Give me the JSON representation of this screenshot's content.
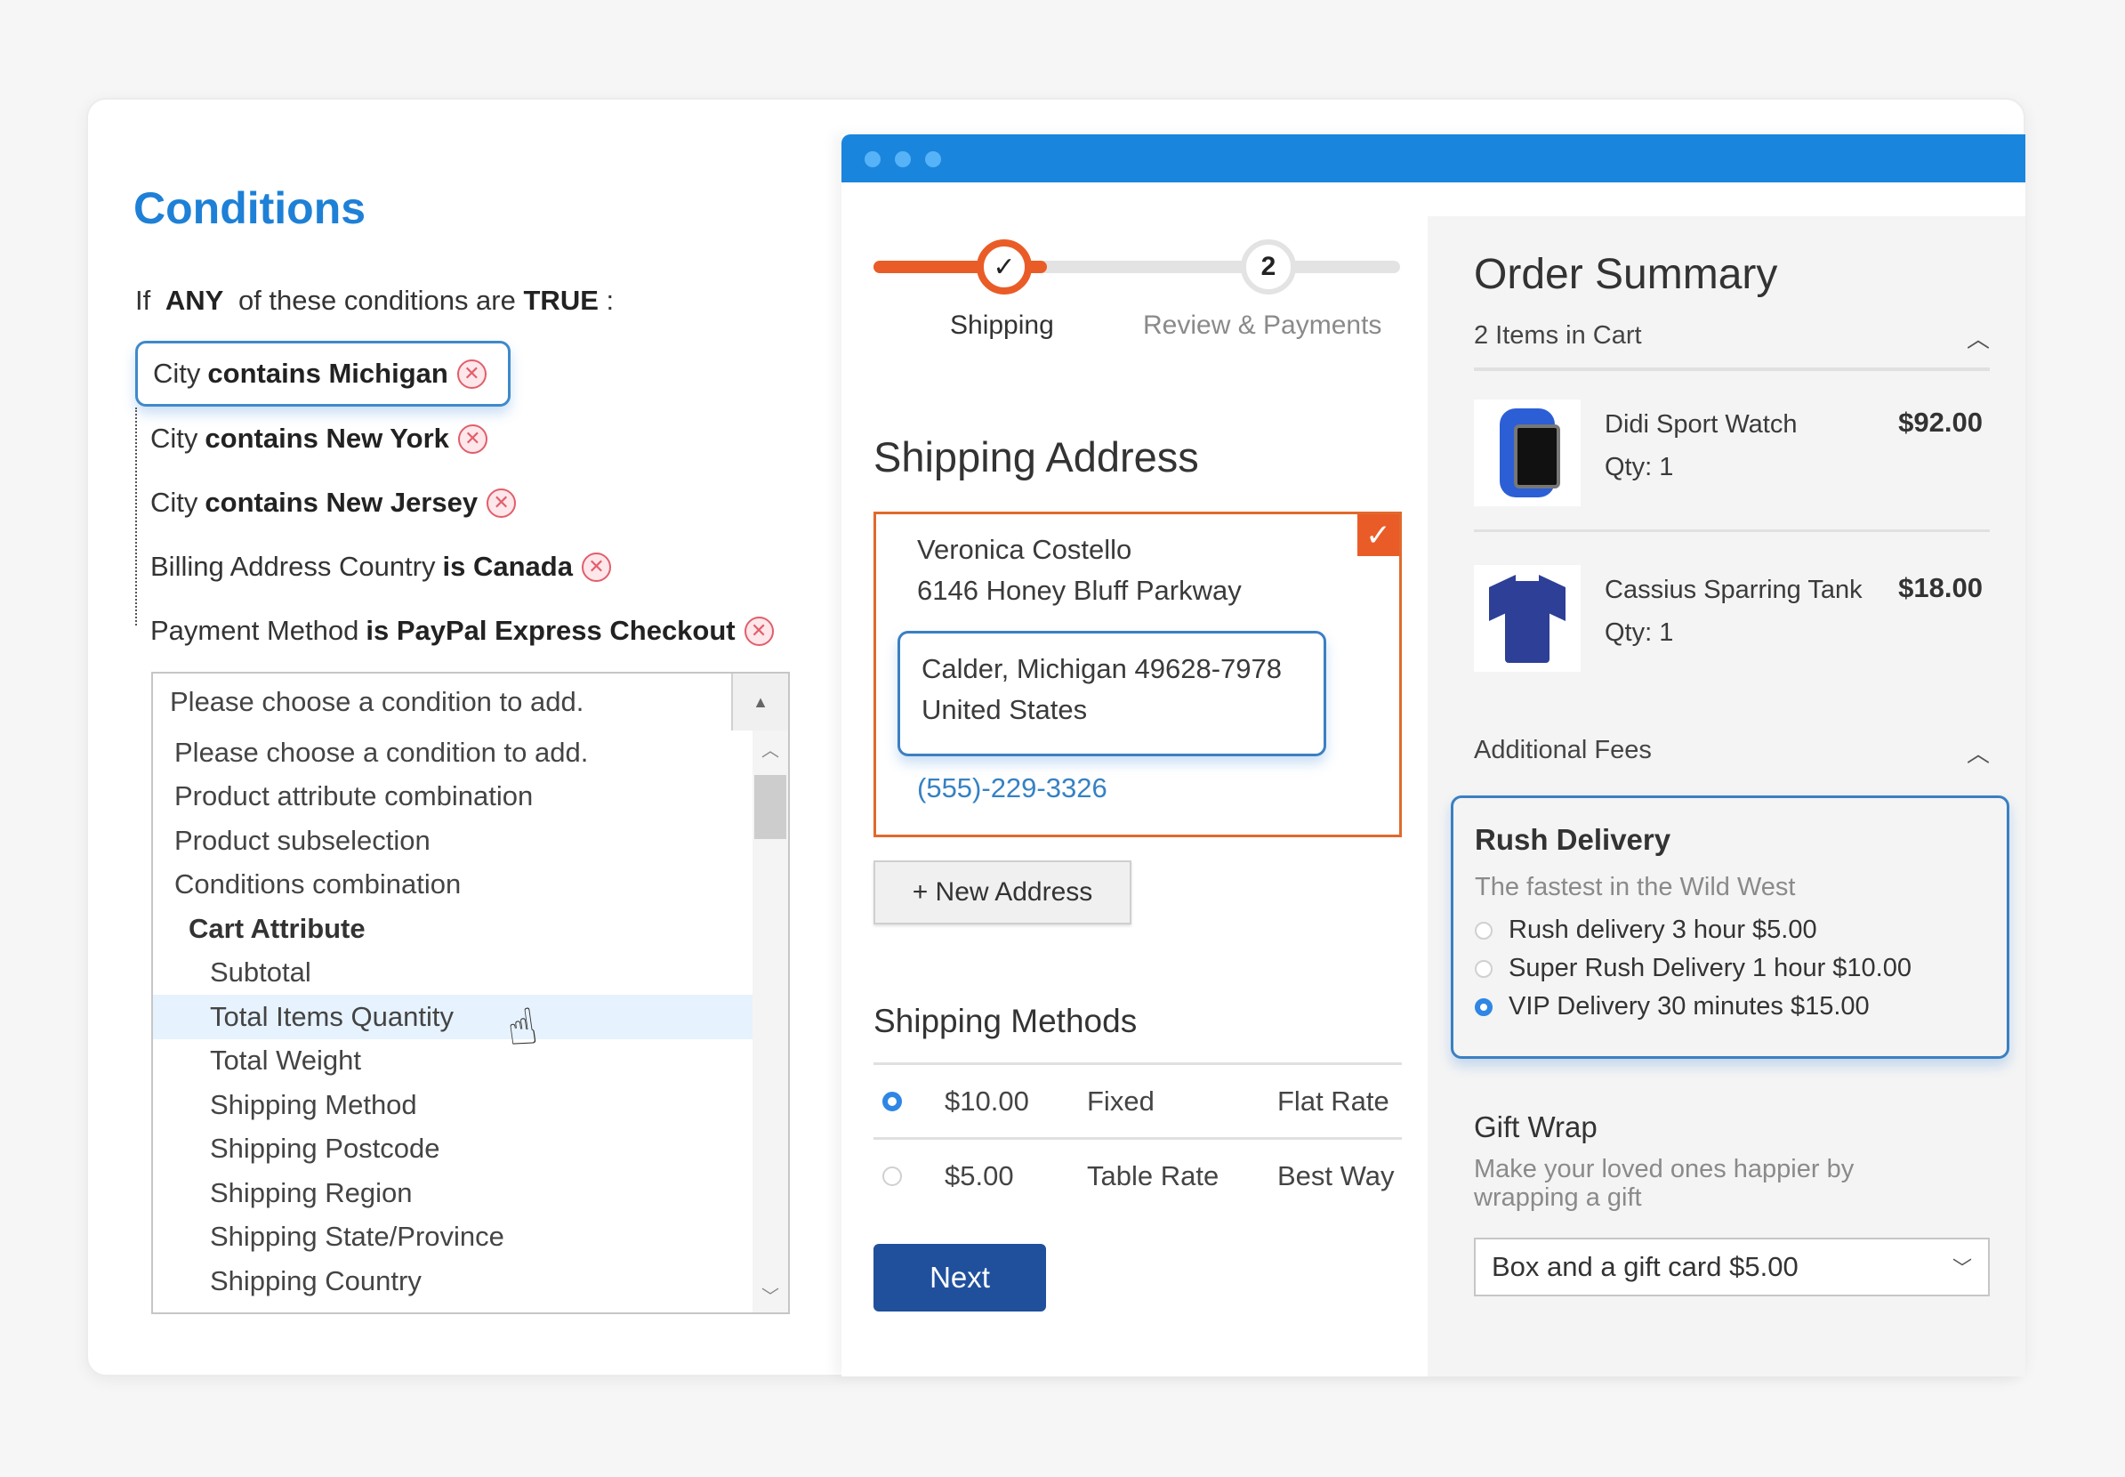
{
  "conditions": {
    "title": "Conditions",
    "intro": {
      "prefix": "If",
      "aggregator": "ANY",
      "middle": "of these conditions are",
      "value": "TRUE",
      "suffix": ":"
    },
    "rules": [
      {
        "attribute": "City",
        "operator_value": "contains Michigan",
        "focused": true
      },
      {
        "attribute": "City",
        "operator_value": "contains New York"
      },
      {
        "attribute": "City",
        "operator_value": "contains New Jersey"
      },
      {
        "attribute": "Billing Address Country",
        "operator_value": "is Canada"
      },
      {
        "attribute": "Payment Method",
        "operator_value": "is PayPal Express Checkout"
      }
    ],
    "remove_icon": "circle-x-icon",
    "select": {
      "value": "Please choose a condition to add.",
      "options": [
        {
          "label": "Please choose a condition to add.",
          "level": 0
        },
        {
          "label": "Product attribute combination",
          "level": 0
        },
        {
          "label": "Product subselection",
          "level": 0
        },
        {
          "label": "Conditions combination",
          "level": 0
        },
        {
          "label": "Cart Attribute",
          "level": 1,
          "group": true
        },
        {
          "label": "Subtotal",
          "level": 2
        },
        {
          "label": "Total Items Quantity",
          "level": 2,
          "hovered": true
        },
        {
          "label": "Total Weight",
          "level": 2
        },
        {
          "label": "Shipping Method",
          "level": 2
        },
        {
          "label": "Shipping Postcode",
          "level": 2
        },
        {
          "label": "Shipping Region",
          "level": 2
        },
        {
          "label": "Shipping State/Province",
          "level": 2
        },
        {
          "label": "Shipping Country",
          "level": 2
        }
      ]
    }
  },
  "checkout": {
    "steps": [
      {
        "label": "Shipping",
        "state": "done",
        "icon": "check-icon"
      },
      {
        "label": "Review & Payments",
        "state": "todo",
        "number": "2"
      }
    ],
    "progress_fraction": 0.33,
    "shipping_address": {
      "title": "Shipping Address",
      "name": "Veronica Costello",
      "street": "6146 Honey Bluff Parkway",
      "city_line": "Calder, Michigan 49628-7978",
      "country": "United States",
      "phone": "(555)-229-3326",
      "selected": true
    },
    "new_address_label": "+ New Address",
    "shipping_methods": {
      "title": "Shipping Methods",
      "rows": [
        {
          "price": "$10.00",
          "method": "Fixed",
          "carrier": "Flat Rate",
          "selected": true
        },
        {
          "price": "$5.00",
          "method": "Table Rate",
          "carrier": "Best Way",
          "selected": false
        }
      ]
    },
    "next_label": "Next"
  },
  "order_summary": {
    "title": "Order Summary",
    "items_count_label": "2 Items in Cart",
    "items": [
      {
        "name": "Didi Sport Watch",
        "qty": "Qty: 1",
        "price": "$92.00",
        "image": "watch"
      },
      {
        "name": "Cassius Sparring Tank",
        "qty": "Qty: 1",
        "price": "$18.00",
        "image": "shirt"
      }
    ],
    "additional_fees_label": "Additional Fees",
    "rush_delivery": {
      "title": "Rush Delivery",
      "description": "The fastest in the Wild West",
      "options": [
        {
          "label": "Rush delivery 3 hour $5.00",
          "selected": false
        },
        {
          "label": "Super Rush Delivery 1 hour $10.00",
          "selected": false
        },
        {
          "label": "VIP Delivery 30 minutes $15.00",
          "selected": true
        }
      ]
    },
    "gift_wrap": {
      "title": "Gift Wrap",
      "description": "Make your loved ones happier by wrapping a gift",
      "selected": "Box and a gift card $5.00"
    }
  },
  "colors": {
    "accent_blue": "#1e80d6",
    "browser_bar": "#1a85dd",
    "orange": "#ea5c27",
    "next_button": "#20509c",
    "remove_red": "#e35d6a"
  }
}
